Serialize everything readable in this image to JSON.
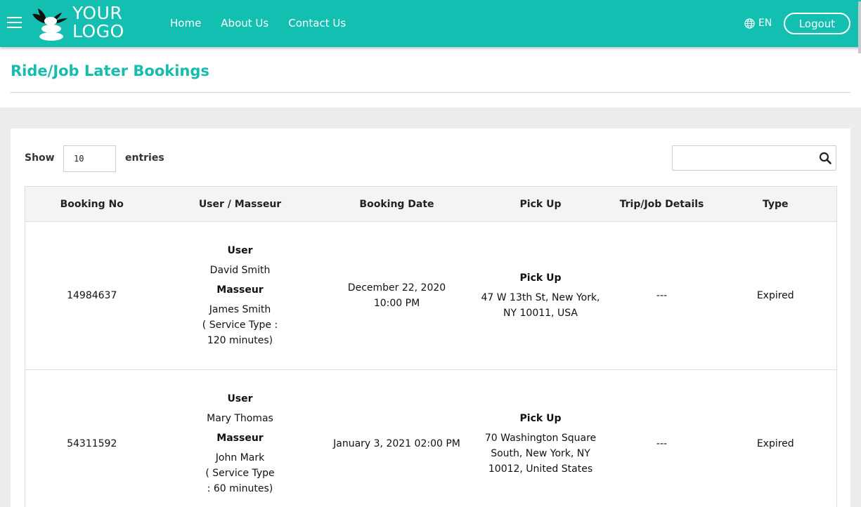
{
  "header": {
    "logo_line1": "YOUR",
    "logo_line2": "LOGO",
    "nav": [
      "Home",
      "About Us",
      "Contact Us"
    ],
    "language": "EN",
    "logout": "Logout"
  },
  "page": {
    "title": "Ride/Job Later Bookings"
  },
  "controls": {
    "show_label": "Show",
    "entries_value": "10",
    "entries_label": "entries",
    "search_value": ""
  },
  "table": {
    "headers": [
      "Booking No",
      "User / Masseur",
      "Booking Date",
      "Pick Up",
      "Trip/Job Details",
      "Type"
    ],
    "rows": [
      {
        "booking_no": "14984637",
        "user_label": "User",
        "user_name": "David Smith",
        "masseur_label": "Masseur",
        "masseur_name": "James Smith",
        "service_type": "( Service Type : 120 minutes)",
        "booking_date": "December 22, 2020 10:00 PM",
        "pickup_label": "Pick Up",
        "pickup_address": "47 W 13th St, New York, NY 10011, USA",
        "details": "---",
        "type": "Expired"
      },
      {
        "booking_no": "54311592",
        "user_label": "User",
        "user_name": "Mary Thomas",
        "masseur_label": "Masseur",
        "masseur_name": "John Mark",
        "service_type": "( Service Type : 60 minutes)",
        "booking_date": "January 3, 2021 02:00 PM",
        "pickup_label": "Pick Up",
        "pickup_address": "70 Washington Square South, New York, NY 10012, United States",
        "details": "---",
        "type": "Expired"
      }
    ]
  },
  "colors": {
    "brand": "#12bfb0",
    "title": "#17bcae"
  }
}
